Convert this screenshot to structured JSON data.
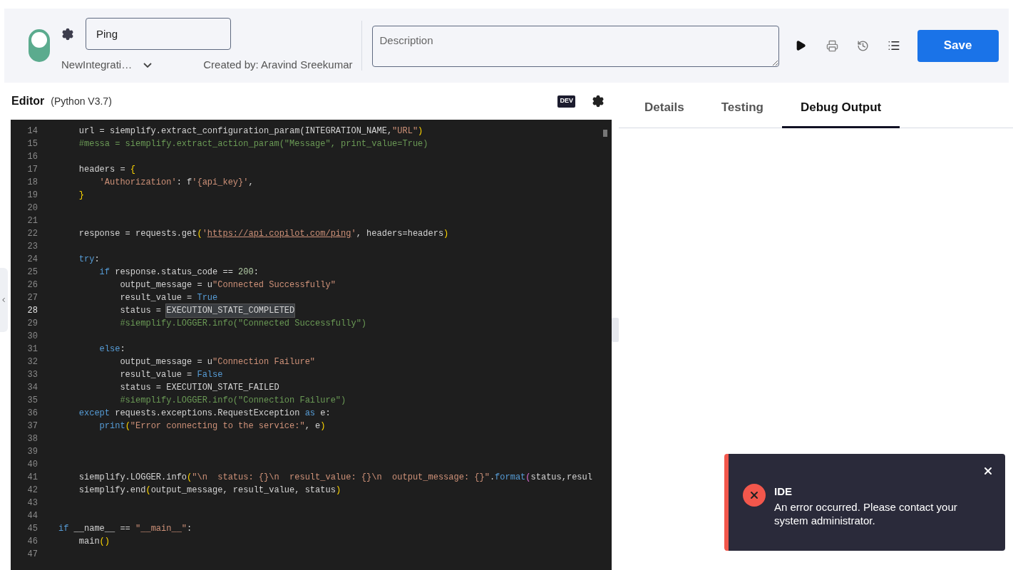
{
  "header": {
    "enabled": true,
    "name_field": {
      "value": "Ping"
    },
    "integration": "NewIntegrati…",
    "created_by": "Created by: Aravind Sreekumar",
    "description": {
      "placeholder": "Description"
    },
    "save_button": "Save"
  },
  "editor": {
    "title": "Editor",
    "language": "(Python V3.7)",
    "badge": "DEV",
    "lines": [
      {
        "number": "14",
        "current": false,
        "tokens": [
          {
            "text": "    url = siemplify.extract_configuration_param(INTEGRATION_NAME,",
            "kind": "plain"
          },
          {
            "text": "\"URL\"",
            "kind": "string"
          },
          {
            "text": ")",
            "kind": "bracket"
          }
        ]
      },
      {
        "number": "15",
        "current": false,
        "tokens": [
          {
            "text": "    #messa = siemplify.extract_action_param(\"Message\", print_value=True)",
            "kind": "comment"
          }
        ]
      },
      {
        "number": "16",
        "current": false
      },
      {
        "number": "17",
        "current": false,
        "tokens": [
          {
            "text": "    headers = ",
            "kind": "plain"
          },
          {
            "text": "{",
            "kind": "bracket"
          }
        ]
      },
      {
        "number": "18",
        "current": false,
        "tokens": [
          {
            "text": "        'Authorization'",
            "kind": "string"
          },
          {
            "text": ": f",
            "kind": "plain"
          },
          {
            "text": "'{api_key}'",
            "kind": "string"
          },
          {
            "text": ",",
            "kind": "plain"
          }
        ]
      },
      {
        "number": "19",
        "current": false,
        "tokens": [
          {
            "text": "    }",
            "kind": "bracket"
          }
        ]
      },
      {
        "number": "20",
        "current": false
      },
      {
        "number": "21",
        "current": false
      },
      {
        "number": "22",
        "current": false,
        "tokens": [
          {
            "text": "    response = requests.get",
            "kind": "plain"
          },
          {
            "text": "(",
            "kind": "bracket"
          },
          {
            "text": "'",
            "kind": "string"
          },
          {
            "text": "https://api.copilot.com/ping",
            "kind": "url"
          },
          {
            "text": "'",
            "kind": "string"
          },
          {
            "text": ", headers=headers",
            "kind": "plain"
          },
          {
            "text": ")",
            "kind": "bracket"
          }
        ]
      },
      {
        "number": "23",
        "current": false
      },
      {
        "number": "24",
        "current": false,
        "tokens": [
          {
            "text": "    try",
            "kind": "keyword"
          },
          {
            "text": ":",
            "kind": "plain"
          }
        ]
      },
      {
        "number": "25",
        "current": false,
        "tokens": [
          {
            "text": "        if",
            "kind": "keyword"
          },
          {
            "text": " response.status_code == ",
            "kind": "plain"
          },
          {
            "text": "200",
            "kind": "number"
          },
          {
            "text": ":",
            "kind": "plain"
          }
        ]
      },
      {
        "number": "26",
        "current": false,
        "tokens": [
          {
            "text": "            output_message = u",
            "kind": "plain"
          },
          {
            "text": "\"Connected Successfully\"",
            "kind": "string"
          }
        ]
      },
      {
        "number": "27",
        "current": false,
        "tokens": [
          {
            "text": "            result_value = ",
            "kind": "plain"
          },
          {
            "text": "True",
            "kind": "keyword"
          }
        ]
      },
      {
        "number": "28",
        "current": true,
        "tokens": [
          {
            "text": "            status = ",
            "kind": "plain"
          },
          {
            "text": "EXECUTION_STATE_COMPLETED",
            "kind": "highlight"
          }
        ]
      },
      {
        "number": "29",
        "current": false,
        "tokens": [
          {
            "text": "            #siemplify.LOGGER.info(\"Connected Successfully\")",
            "kind": "comment"
          }
        ]
      },
      {
        "number": "30",
        "current": false
      },
      {
        "number": "31",
        "current": false,
        "tokens": [
          {
            "text": "        else",
            "kind": "keyword"
          },
          {
            "text": ":",
            "kind": "plain"
          }
        ]
      },
      {
        "number": "32",
        "current": false,
        "tokens": [
          {
            "text": "            output_message = u",
            "kind": "plain"
          },
          {
            "text": "\"Connection Failure\"",
            "kind": "string"
          }
        ]
      },
      {
        "number": "33",
        "current": false,
        "tokens": [
          {
            "text": "            result_value = ",
            "kind": "plain"
          },
          {
            "text": "False",
            "kind": "keyword"
          }
        ]
      },
      {
        "number": "34",
        "current": false,
        "tokens": [
          {
            "text": "            status = EXECUTION_STATE_FAILED",
            "kind": "plain"
          }
        ]
      },
      {
        "number": "35",
        "current": false,
        "tokens": [
          {
            "text": "            #siemplify.LOGGER.info(\"Connection Failure\")",
            "kind": "comment"
          }
        ]
      },
      {
        "number": "36",
        "current": false,
        "tokens": [
          {
            "text": "    except",
            "kind": "keyword"
          },
          {
            "text": " requests.exceptions.RequestException ",
            "kind": "plain"
          },
          {
            "text": "as",
            "kind": "keyword"
          },
          {
            "text": " e:",
            "kind": "plain"
          }
        ]
      },
      {
        "number": "37",
        "current": false,
        "tokens": [
          {
            "text": "        print",
            "kind": "func"
          },
          {
            "text": "(",
            "kind": "bracket"
          },
          {
            "text": "\"Error connecting to the service:\"",
            "kind": "string"
          },
          {
            "text": ", e",
            "kind": "plain"
          },
          {
            "text": ")",
            "kind": "bracket"
          }
        ]
      },
      {
        "number": "38",
        "current": false
      },
      {
        "number": "39",
        "current": false
      },
      {
        "number": "40",
        "current": false
      },
      {
        "number": "41",
        "current": false,
        "tokens": [
          {
            "text": "    siemplify.LOGGER.info",
            "kind": "plain"
          },
          {
            "text": "(",
            "kind": "bracket"
          },
          {
            "text": "\"\\n  status: {}\\n  result_value: {}\\n  output_message: {}\"",
            "kind": "string"
          },
          {
            "text": ".",
            "kind": "plain"
          },
          {
            "text": "format",
            "kind": "func"
          },
          {
            "text": "(",
            "kind": "bracket2"
          },
          {
            "text": "status,resul",
            "kind": "plain"
          }
        ]
      },
      {
        "number": "42",
        "current": false,
        "tokens": [
          {
            "text": "    siemplify.end",
            "kind": "plain"
          },
          {
            "text": "(",
            "kind": "bracket"
          },
          {
            "text": "output_message, result_value, status",
            "kind": "plain"
          },
          {
            "text": ")",
            "kind": "bracket"
          }
        ]
      },
      {
        "number": "43",
        "current": false
      },
      {
        "number": "44",
        "current": false
      },
      {
        "number": "45",
        "current": false,
        "tokens": [
          {
            "text": "if",
            "kind": "keyword"
          },
          {
            "text": " __name__ == ",
            "kind": "plain"
          },
          {
            "text": "\"__main__\"",
            "kind": "string"
          },
          {
            "text": ":",
            "kind": "plain"
          }
        ]
      },
      {
        "number": "46",
        "current": false,
        "tokens": [
          {
            "text": "    main",
            "kind": "plain"
          },
          {
            "text": "()",
            "kind": "bracket"
          }
        ]
      },
      {
        "number": "47",
        "current": false
      }
    ]
  },
  "tabs": [
    {
      "label": "Details",
      "selected": false
    },
    {
      "label": "Testing",
      "selected": false
    },
    {
      "label": "Debug Output",
      "selected": true
    }
  ],
  "toast": {
    "title": "IDE",
    "message": "An error occurred. Please contact your system administrator."
  }
}
